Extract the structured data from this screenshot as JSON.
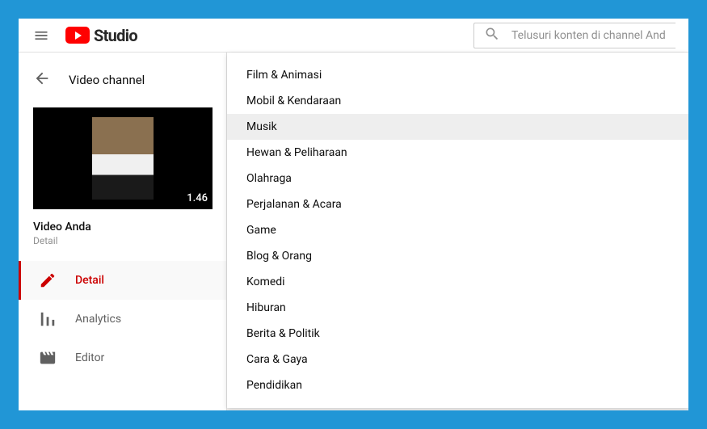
{
  "header": {
    "brand": "Studio",
    "search_placeholder": "Telusuri konten di channel Anda"
  },
  "sidebar": {
    "breadcrumb": "Video channel",
    "video": {
      "title": "Video Anda",
      "subtitle": "Detail",
      "duration": "1.46"
    },
    "nav": [
      {
        "icon": "pencil-icon",
        "label": "Detail",
        "active": true
      },
      {
        "icon": "analytics-icon",
        "label": "Analytics",
        "active": false
      },
      {
        "icon": "editor-icon",
        "label": "Editor",
        "active": false
      }
    ]
  },
  "dropdown": {
    "selected_index": 2,
    "items": [
      "Film & Animasi",
      "Mobil & Kendaraan",
      "Musik",
      "Hewan & Peliharaan",
      "Olahraga",
      "Perjalanan & Acara",
      "Game",
      "Blog & Orang",
      "Komedi",
      "Hiburan",
      "Berita & Politik",
      "Cara & Gaya",
      "Pendidikan"
    ]
  }
}
